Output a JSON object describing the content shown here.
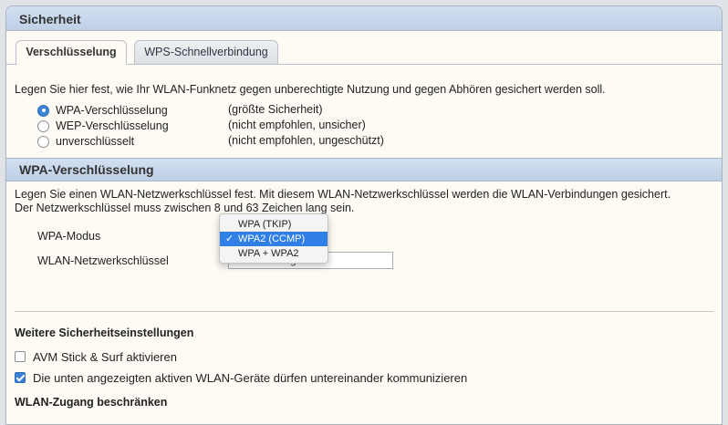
{
  "section1": {
    "title": "Sicherheit"
  },
  "tabs": [
    {
      "label": "Verschlüsselung",
      "active": true
    },
    {
      "label": "WPS-Schnellverbindung",
      "active": false
    }
  ],
  "intro": "Legen Sie hier fest, wie Ihr WLAN-Funknetz gegen unberechtigte Nutzung und gegen Abhören gesichert werden soll.",
  "encryption_options": [
    {
      "label": "WPA-Verschlüsselung",
      "note": "(größte Sicherheit)",
      "checked": true
    },
    {
      "label": "WEP-Verschlüsselung",
      "note": "(nicht empfohlen, unsicher)",
      "checked": false
    },
    {
      "label": "unverschlüsselt",
      "note": "(nicht empfohlen, ungeschützt)",
      "checked": false
    }
  ],
  "section2": {
    "title": "WPA-Verschlüsselung",
    "intro_line1": "Legen Sie einen WLAN-Netzwerkschlüssel fest. Mit diesem WLAN-Netzwerkschlüssel werden die WLAN-Verbindungen gesichert.",
    "intro_line2": "Der Netzwerkschlüssel muss zwischen 8 und 63 Zeichen lang sein.",
    "mode_label": "WPA-Modus",
    "key_label": "WLAN-Netzwerkschlüssel",
    "key_value": "keine-ahnung",
    "mode_options": [
      {
        "label": "WPA (TKIP)",
        "selected": false
      },
      {
        "label": "WPA2 (CCMP)",
        "selected": true
      },
      {
        "label": "WPA + WPA2",
        "selected": false
      }
    ],
    "check_glyph": "✓"
  },
  "more_settings": {
    "title": "Weitere Sicherheitseinstellungen",
    "options": [
      {
        "label": "AVM Stick & Surf aktivieren",
        "checked": false
      },
      {
        "label": "Die unten angezeigten aktiven WLAN-Geräte dürfen untereinander kommunizieren",
        "checked": true
      }
    ]
  },
  "access": {
    "title": "WLAN-Zugang beschränken"
  },
  "colors": {
    "accent": "#2f7fe6",
    "header": "#c7d7ec",
    "panel": "#fdfbf4"
  }
}
